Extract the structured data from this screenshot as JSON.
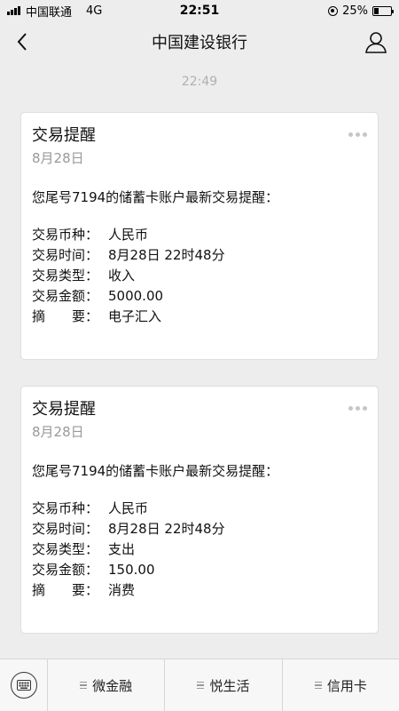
{
  "status_bar": {
    "carrier": "中国联通",
    "network": "4G",
    "time": "22:51",
    "battery": "25%",
    "battery_level": 0.25
  },
  "nav": {
    "title": "中国建设银行",
    "back_icon": "chevron-left-icon",
    "profile_icon": "person-icon"
  },
  "chat": {
    "timestamp": "22:49",
    "messages": [
      {
        "title": "交易提醒",
        "date": "8月28日",
        "intro": "您尾号7194的储蓄卡账户最新交易提醒：",
        "rows": [
          {
            "label": "交易币种：",
            "value": "人民币"
          },
          {
            "label": "交易时间：",
            "value": "8月28日 22时48分"
          },
          {
            "label": "交易类型：",
            "value": "收入"
          },
          {
            "label": "交易金额：",
            "value": "5000.00"
          },
          {
            "label": "摘　　要：",
            "value": "电子汇入"
          }
        ]
      },
      {
        "title": "交易提醒",
        "date": "8月28日",
        "intro": "您尾号7194的储蓄卡账户最新交易提醒：",
        "rows": [
          {
            "label": "交易币种：",
            "value": "人民币"
          },
          {
            "label": "交易时间：",
            "value": "8月28日 22时48分"
          },
          {
            "label": "交易类型：",
            "value": "支出"
          },
          {
            "label": "交易金额：",
            "value": "150.00"
          },
          {
            "label": "摘　　要：",
            "value": "消费"
          }
        ]
      }
    ]
  },
  "bottom_menu": {
    "keyboard_icon": "keyboard-icon",
    "items": [
      {
        "label": "微金融"
      },
      {
        "label": "悦生活"
      },
      {
        "label": "信用卡"
      }
    ]
  },
  "colors": {
    "background": "#ededed",
    "card": "#ffffff",
    "muted_text": "#999999",
    "timestamp_text": "#b0b0b0"
  }
}
